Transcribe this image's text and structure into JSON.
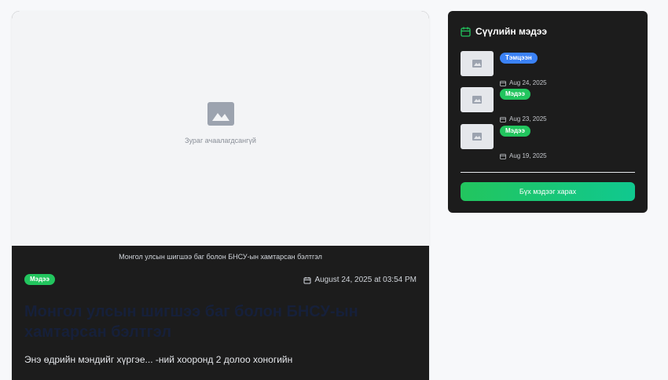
{
  "article": {
    "image_placeholder_text": "Зураг ачаалагдсангүй",
    "caption": "Монгол улсын шигшээ баг болон БНСУ-ын хамтарсан бэлтгэл",
    "badge": "Мэдээ",
    "date": "August 24, 2025 at 03:54 PM",
    "title": "Монгол улсын шигшээ баг болон БНСУ-ын хамтарсан бэлтгэл",
    "excerpt": "Энэ өдрийн мэндийг хүргэе...                              -ний хооронд 2 долоо хоногийн"
  },
  "sidebar": {
    "title": "Сүүлийн мэдээ",
    "items": [
      {
        "badge": "Тэмцээн",
        "badge_color": "#3b82f6",
        "date": "Aug 24, 2025"
      },
      {
        "badge": "Мэдээ",
        "badge_color": "#22c55e",
        "date": "Aug 23, 2025"
      },
      {
        "badge": "Мэдээ",
        "badge_color": "#22c55e",
        "date": "Aug 19, 2025"
      }
    ],
    "all_news_button": "Бүх мэдээг харах"
  },
  "colors": {
    "accent_green": "#22c55e",
    "accent_blue": "#3b82f6",
    "card_dark": "#1c1c1c"
  }
}
